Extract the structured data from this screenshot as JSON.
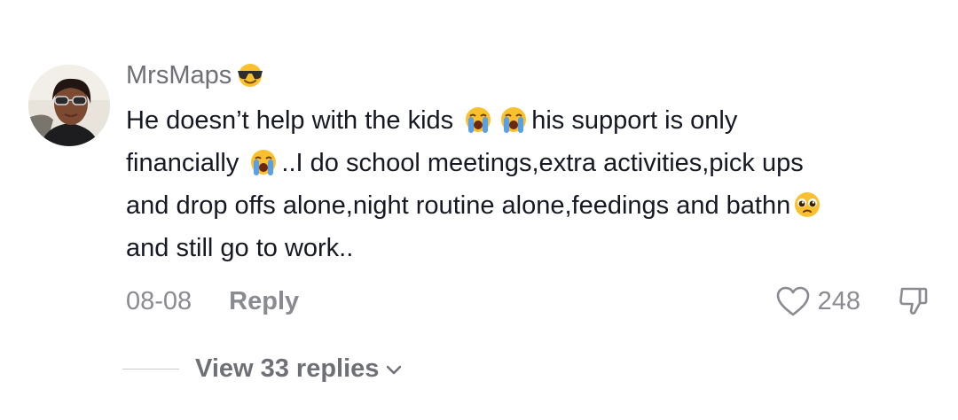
{
  "comment": {
    "username": "MrsMaps",
    "username_emoji": "smiling-face-with-sunglasses-emoji",
    "body_lines": [
      {
        "parts": [
          "He doesn’t help with the kids ",
          "his support is only"
        ],
        "emojis": [
          "loudly-crying-face-emoji",
          "loudly-crying-face-emoji"
        ]
      },
      {
        "parts": [
          "financially ",
          "..I do school meetings,extra activities,pick ups"
        ],
        "emojis": [
          "loudly-crying-face-emoji"
        ]
      },
      {
        "parts": [
          "and drop offs alone,night routine alone,feedings and bathn"
        ],
        "emojis": [
          "pleading-face-emoji"
        ]
      },
      {
        "parts": [
          "and still go to work.."
        ],
        "emojis": []
      }
    ],
    "date": "08-08",
    "reply_label": "Reply",
    "like_count": "248",
    "view_replies_label": "View 33 replies"
  },
  "colors": {
    "text": "#161823",
    "secondary": "#8a8b91",
    "username": "#6f7076",
    "emoji_yellow": "#fbc02d",
    "tear_blue": "#5aa0e6"
  }
}
